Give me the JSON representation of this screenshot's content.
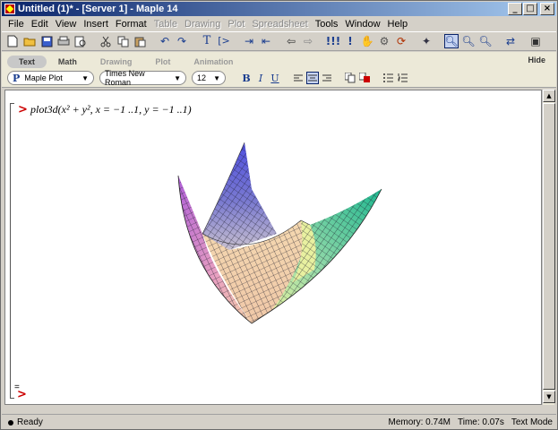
{
  "window": {
    "title": "Untitled (1)* - [Server 1] - Maple 14",
    "controls": {
      "minimize": "_",
      "maximize": "□",
      "close": "×"
    }
  },
  "menu": [
    {
      "label": "File",
      "enabled": true
    },
    {
      "label": "Edit",
      "enabled": true
    },
    {
      "label": "View",
      "enabled": true
    },
    {
      "label": "Insert",
      "enabled": true
    },
    {
      "label": "Format",
      "enabled": true
    },
    {
      "label": "Table",
      "enabled": false
    },
    {
      "label": "Drawing",
      "enabled": false
    },
    {
      "label": "Plot",
      "enabled": false
    },
    {
      "label": "Spreadsheet",
      "enabled": false
    },
    {
      "label": "Tools",
      "enabled": true
    },
    {
      "label": "Window",
      "enabled": true
    },
    {
      "label": "Help",
      "enabled": true
    }
  ],
  "toolbar": {
    "icons": [
      "new-icon",
      "open-icon",
      "save-icon",
      "print-icon",
      "print-preview-icon",
      "cut-icon",
      "copy-icon",
      "paste-icon",
      "undo-icon",
      "redo-icon",
      "text-icon",
      "math-icon",
      "indent-icon",
      "outdent-icon",
      "back-icon",
      "forward-icon",
      "execute-all-icon",
      "execute-icon",
      "stop-icon",
      "debug-icon",
      "restart-icon",
      "gear-icon",
      "zoom-100-icon",
      "zoom-150-icon",
      "zoom-200-icon",
      "show-hide-icon",
      "help-icon"
    ]
  },
  "context_bar": {
    "tabs": [
      {
        "label": "Text",
        "active": true
      },
      {
        "label": "Math",
        "active": false
      },
      {
        "label": "Drawing",
        "active": false
      },
      {
        "label": "Plot",
        "active": false
      },
      {
        "label": "Animation",
        "active": false
      }
    ],
    "hide_label": "Hide",
    "style_select": {
      "prefix": "P",
      "value": "Maple Plot"
    },
    "font_select": {
      "value": "Times New Roman"
    },
    "size_select": {
      "value": "12"
    },
    "format_buttons": {
      "bold": "B",
      "italic": "I",
      "underline": "U"
    }
  },
  "document": {
    "prompt": ">",
    "command": "plot3d(x² + y², x = −1 ..1, y = −1 ..1)",
    "empty_prompt": ">",
    "equals_marker": "="
  },
  "plot": {
    "type": "surface3d",
    "function": "x^2 + y^2",
    "x_range": [
      -1,
      1
    ],
    "y_range": [
      -1,
      1
    ],
    "colors": {
      "top": "#4b4bd6",
      "left": "#c870d8",
      "right": "#2ebf9a",
      "bottom": "#f2c8a0",
      "yellow": "#e8f0a0"
    }
  },
  "status": {
    "state": "Ready",
    "memory": "Memory: 0.74M",
    "time": "Time: 0.07s",
    "mode": "Text Mode"
  }
}
